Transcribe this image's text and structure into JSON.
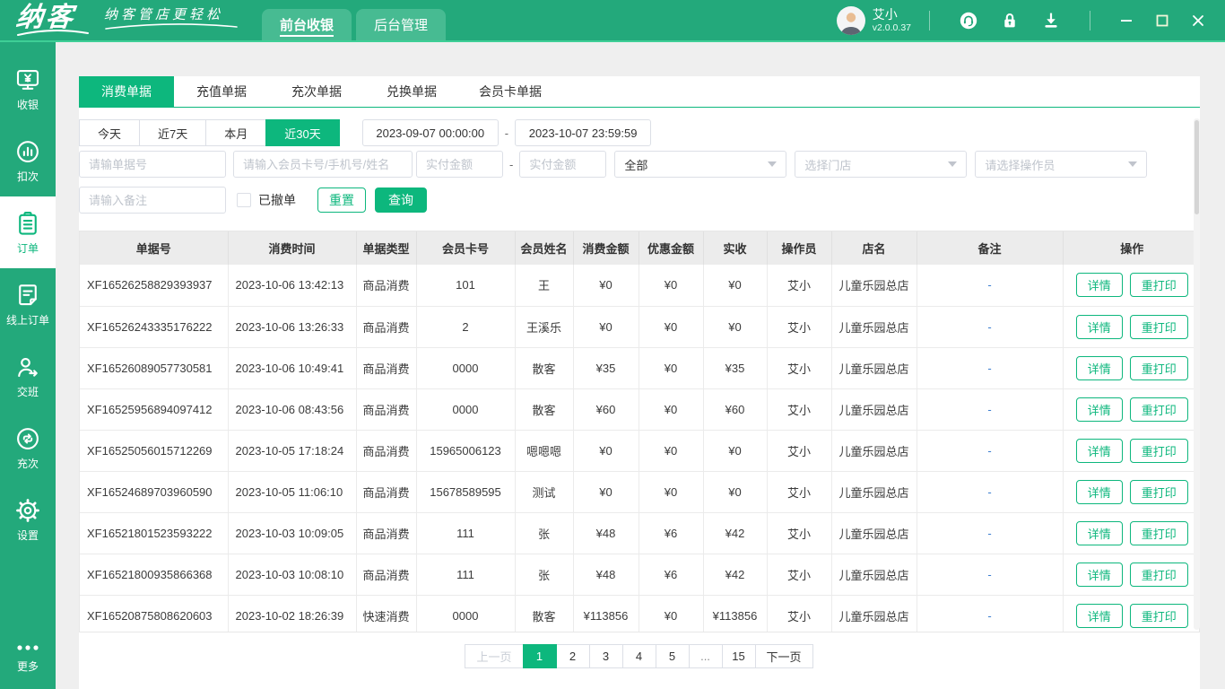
{
  "titlebar": {
    "logo": "纳客",
    "slogan": "纳客管店更轻松",
    "nav_tabs": [
      {
        "label": "前台收银",
        "active": true
      },
      {
        "label": "后台管理",
        "active": false
      }
    ],
    "user": {
      "name": "艾小",
      "version": "v2.0.0.37"
    },
    "icons": [
      "customer-service-icon",
      "lock-icon",
      "download-icon"
    ],
    "window_controls": [
      "minimize",
      "maximize",
      "close"
    ]
  },
  "sidebar": {
    "items": [
      {
        "label": "收银",
        "icon": "cashier-icon",
        "active": false
      },
      {
        "label": "扣次",
        "icon": "deduct-icon",
        "active": false
      },
      {
        "label": "订单",
        "icon": "orders-icon",
        "active": true
      },
      {
        "label": "线上订单",
        "icon": "online-orders-icon",
        "active": false
      },
      {
        "label": "交班",
        "icon": "shift-icon",
        "active": false
      },
      {
        "label": "充次",
        "icon": "recharge-icon",
        "active": false
      },
      {
        "label": "设置",
        "icon": "settings-icon",
        "active": false
      }
    ],
    "more": {
      "label": "更多",
      "icon": "more-icon"
    }
  },
  "tabs": [
    {
      "label": "消费单据",
      "active": true
    },
    {
      "label": "充值单据",
      "active": false
    },
    {
      "label": "充次单据",
      "active": false
    },
    {
      "label": "兑换单据",
      "active": false
    },
    {
      "label": "会员卡单据",
      "active": false
    }
  ],
  "filters": {
    "quick_ranges": [
      {
        "label": "今天",
        "active": false
      },
      {
        "label": "近7天",
        "active": false
      },
      {
        "label": "本月",
        "active": false
      },
      {
        "label": "近30天",
        "active": true
      }
    ],
    "date_from": "2023-09-07 00:00:00",
    "range_separator": "-",
    "date_to": "2023-10-07 23:59:59",
    "order_no_placeholder": "请输单据号",
    "member_placeholder": "请输入会员卡号/手机号/姓名",
    "amount_min_placeholder": "实付金额",
    "amount_separator": "-",
    "amount_max_placeholder": "实付金额",
    "type_selected": "全部",
    "store_placeholder": "选择门店",
    "operator_placeholder": "请选择操作员",
    "remark_placeholder": "请输入备注",
    "revoked_label": "已撤单",
    "reset_label": "重置",
    "query_label": "查询"
  },
  "table": {
    "columns": [
      "单据号",
      "消费时间",
      "单据类型",
      "会员卡号",
      "会员姓名",
      "消费金额",
      "优惠金额",
      "实收",
      "操作员",
      "店名",
      "备注",
      "操作"
    ],
    "action_labels": [
      "详情",
      "重打印"
    ],
    "rows": [
      [
        "XF16526258829393937",
        "2023-10-06 13:42:13",
        "商品消费",
        "101",
        "王",
        "¥0",
        "¥0",
        "¥0",
        "艾小",
        "儿童乐园总店",
        "-"
      ],
      [
        "XF16526243335176222",
        "2023-10-06 13:26:33",
        "商品消费",
        "2",
        "王溪乐",
        "¥0",
        "¥0",
        "¥0",
        "艾小",
        "儿童乐园总店",
        "-"
      ],
      [
        "XF16526089057730581",
        "2023-10-06 10:49:41",
        "商品消费",
        "0000",
        "散客",
        "¥35",
        "¥0",
        "¥35",
        "艾小",
        "儿童乐园总店",
        "-"
      ],
      [
        "XF16525956894097412",
        "2023-10-06 08:43:56",
        "商品消费",
        "0000",
        "散客",
        "¥60",
        "¥0",
        "¥60",
        "艾小",
        "儿童乐园总店",
        "-"
      ],
      [
        "XF16525056015712269",
        "2023-10-05 17:18:24",
        "商品消费",
        "15965006123",
        "嗯嗯嗯",
        "¥0",
        "¥0",
        "¥0",
        "艾小",
        "儿童乐园总店",
        "-"
      ],
      [
        "XF16524689703960590",
        "2023-10-05 11:06:10",
        "商品消费",
        "15678589595",
        "测试",
        "¥0",
        "¥0",
        "¥0",
        "艾小",
        "儿童乐园总店",
        "-"
      ],
      [
        "XF16521801523593222",
        "2023-10-03 10:09:05",
        "商品消费",
        "111",
        "张",
        "¥48",
        "¥6",
        "¥42",
        "艾小",
        "儿童乐园总店",
        "-"
      ],
      [
        "XF16521800935866368",
        "2023-10-03 10:08:10",
        "商品消费",
        "111",
        "张",
        "¥48",
        "¥6",
        "¥42",
        "艾小",
        "儿童乐园总店",
        "-"
      ],
      [
        "XF16520875808620603",
        "2023-10-02 18:26:39",
        "快速消费",
        "0000",
        "散客",
        "¥113856",
        "¥0",
        "¥113856",
        "艾小",
        "儿童乐园总店",
        "-"
      ]
    ]
  },
  "pagination": {
    "prev": "上一页",
    "pages": [
      "1",
      "2",
      "3",
      "4",
      "5",
      "...",
      "15"
    ],
    "active_page": "1",
    "next": "下一页"
  },
  "colors": {
    "brand_green": "#23a97b",
    "chip_green": "#47bb92",
    "accent_green": "#0db77d",
    "accent_line": "#3ecf96",
    "remark_blue": "#3d7fd0"
  }
}
